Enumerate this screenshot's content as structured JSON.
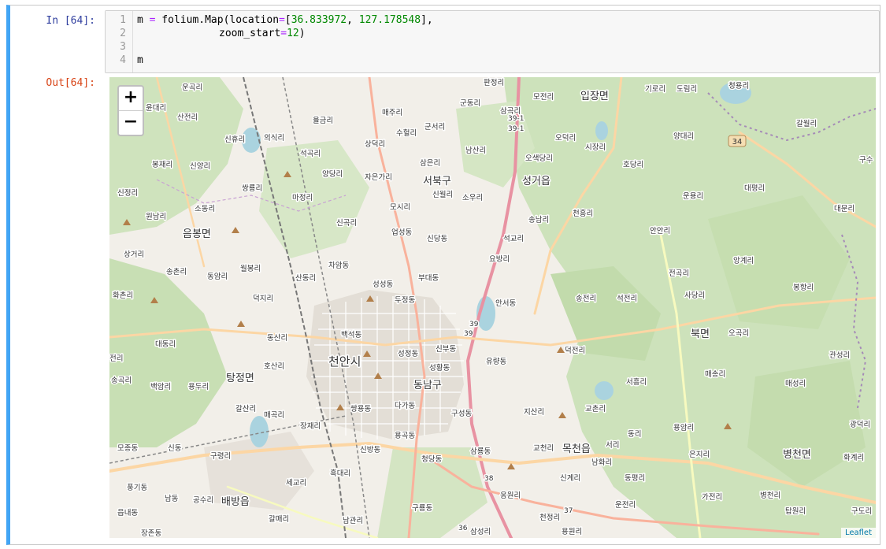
{
  "cell": {
    "in_prompt": "In [64]:",
    "out_prompt": "Out[64]:",
    "line_numbers": [
      "1",
      "2",
      "3",
      "4"
    ],
    "code": {
      "line1_pre": "m ",
      "line1_eq": "=",
      "line1_call": " folium.Map(location",
      "line1_eq2": "=",
      "line1_open": "[",
      "line1_lat": "36.833972",
      "line1_sep": ", ",
      "line1_lon": "127.178548",
      "line1_close": "],",
      "line2_pre": "zoom_start",
      "line2_eq": "=",
      "line2_num": "12",
      "line2_close": ")",
      "line4": "m"
    }
  },
  "map": {
    "zoom_in_label": "+",
    "zoom_out_label": "−",
    "attribution": "Leaflet",
    "labels": {
      "cheonan": "천안시",
      "dongnam": "동남구",
      "seobuk": "서북구",
      "seonggeo": "성거읍",
      "ipjang": "입장면",
      "eumbong": "음봉면",
      "tangjeong": "탕정면",
      "baebang": "배방읍",
      "mokcheon": "목천읍",
      "buk": "북면",
      "byeongcheon": "병천면",
      "pangjeong": "판정리",
      "moden": "모전리",
      "gunmul": "군동리",
      "samgok": "삼곡리",
      "gunseo": "군서리",
      "namsan": "남산리",
      "osaek": "오색당리",
      "odeok": "오덕리",
      "sijang": "시장리",
      "hodang": "호당리",
      "yangdae": "양대리",
      "daepyeong": "대평리",
      "daemun": "대문리",
      "unyong": "운용리",
      "cheongheung": "천흥리",
      "songnam": "송남리",
      "seokgyo": "석교리",
      "yobang": "요방리",
      "anseo": "안서동",
      "sincheong": "신당동",
      "eopseong": "업성동",
      "buedae": "부대동",
      "seongseong": "성성동",
      "dujeong": "두정동",
      "baekseok": "백석동",
      "seongjeong": "성정동",
      "sinbu": "신부동",
      "seonghwang": "성황동",
      "yuryang": "유량동",
      "dakadong": "다가동",
      "ssangyong": "쌍용동",
      "guseong": "구성동",
      "sinbang": "신방동",
      "yonggok": "용곡동",
      "cheongdang": "청당동",
      "samnyong": "삼룡동",
      "gyocheon": "교천리",
      "jisan": "지산리",
      "gyochon": "교촌리",
      "deokjeon": "덕전리",
      "seoheung": "서흥리",
      "songjeon": "송전리",
      "seokjeon": "석전리",
      "sadang": "사당리",
      "ogok": "오곡리",
      "maesong": "매송리",
      "maeseong": "매성리",
      "gwanseong": "관성리",
      "bonghang": "봉항리",
      "angye": "앙계리",
      "jeonguk": "전곡리",
      "anyeong": "안안리",
      "yonggam": "용암리",
      "eunji": "은지리",
      "hwagye": "화계리",
      "gwangdeok": "광덕리",
      "gajeon": "가전리",
      "byeongcheonri": "병천리",
      "tamwon": "탑원리",
      "gudo": "구도리",
      "namhwa": "남화리",
      "seori": "서리",
      "dongri": "동리",
      "singye": "신계리",
      "dongpyeong": "동평리",
      "unjeon": "운전리",
      "eungwon": "응원리",
      "cheonjeong": "천정리",
      "yongwon": "용원리",
      "samseong": "삼성리",
      "guryong": "구룡동",
      "gwanri": "남관리",
      "galmae": "갈매리",
      "heukdae": "흑대리",
      "segyo": "세교리",
      "jangjae": "장재리",
      "maegok": "매곡리",
      "galsan": "갈산리",
      "hosan": "호산리",
      "dongsan": "동산리",
      "yongdu": "용두리",
      "baegam": "백암리",
      "songgok": "송곡리",
      "daedong": "대동리",
      "deokji": "덕지리",
      "dongam": "동암리",
      "songchon": "송촌리",
      "sanggeo": "상거리",
      "wonnam": "원남리",
      "sodong": "소동리",
      "sinjeong": "신정리",
      "bongjae": "봉재리",
      "sinyang": "신양리",
      "sanjeon": "산전리",
      "sinhyu": "신휴리",
      "ungdae": "윤대리",
      "ungwoli": "운곡리",
      "uisik": "의식리",
      "seokgok": "석곡리",
      "yanggok": "양당리",
      "jaeun": "자은가리",
      "ssangryong": "쌍룡리",
      "majeong": "마정리",
      "mosi": "모시리",
      "sinwol": "신월리",
      "souri": "소우리",
      "samseong2": "삼은리",
      "sangdeok": "상덕리",
      "suheon": "수헐리",
      "maeju": "매주리",
      "yulgeum": "율금리",
      "singwang": "신곡리",
      "chaam": "차암동",
      "sandong": "산동리",
      "wolbong": "월봉리",
      "hwachon": "화촌리",
      "baebangri": "공수리",
      "modong": "모종동",
      "sindong": "신동",
      "guryeong": "구령리",
      "punggi": "풍기동",
      "namdong": "남동",
      "eupnae": "읍내동",
      "jangjeon": "장존동",
      "giro": "기로리",
      "dorim": "도림리",
      "cheongyong": "청용리",
      "galwol": "갈월리",
      "gusu": "구수",
      "road34": "34",
      "road39a": "39-1",
      "road39b": "39-1",
      "road39c": "39",
      "road39d": "39",
      "road38": "38",
      "road37": "37",
      "road36": "36",
      "jeju": "전리"
    }
  }
}
